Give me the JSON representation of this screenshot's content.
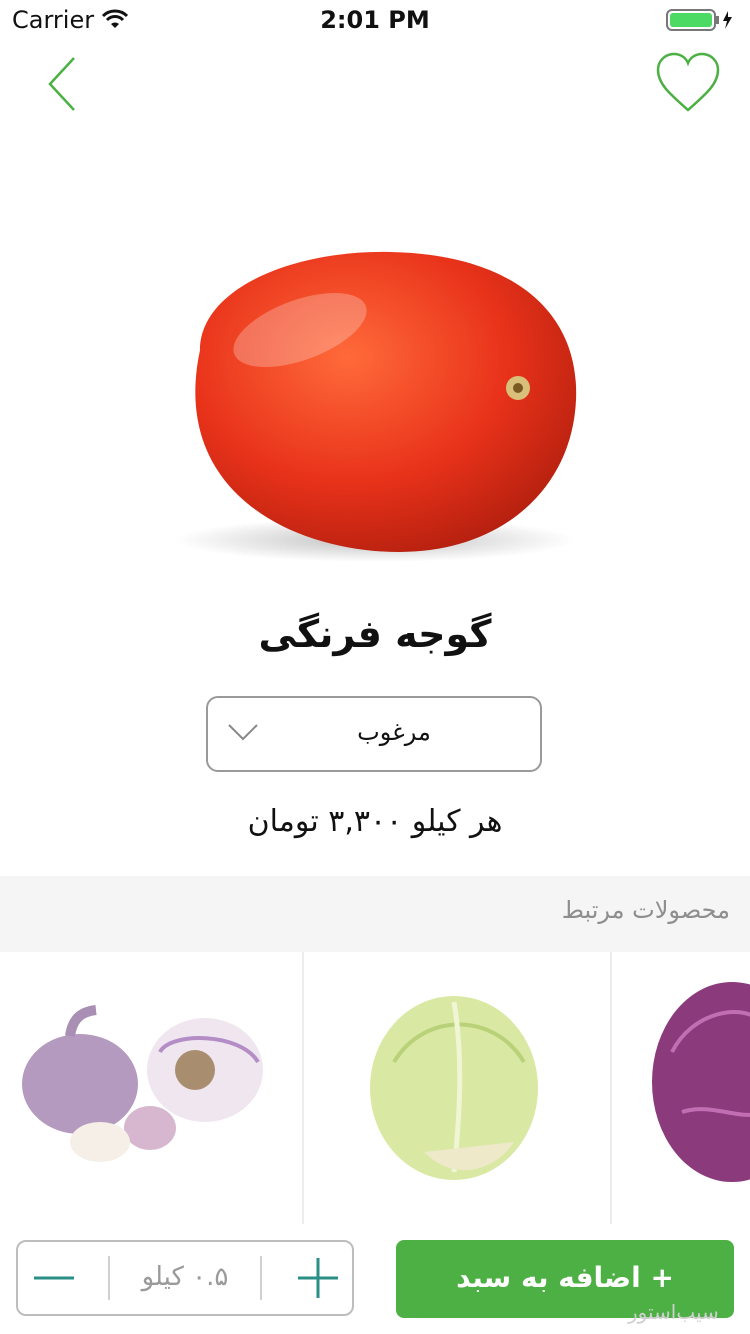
{
  "status_bar": {
    "carrier": "Carrier",
    "time": "2:01 PM"
  },
  "product": {
    "title": "گوجه فرنگی",
    "grade_selected": "مرغوب",
    "price_text": "هر کیلو ۳,۳۰۰ تومان"
  },
  "related": {
    "title": "محصولات مرتبط",
    "items": [
      {
        "icon": "garlic"
      },
      {
        "icon": "white-cabbage"
      },
      {
        "icon": "red-cabbage"
      }
    ]
  },
  "cart": {
    "quantity_text": "۰.۵ کیلو",
    "add_label": "+ اضافه به سبد"
  },
  "watermark": "سیب‌استور",
  "colors": {
    "accent": "#4db044",
    "stepper_icon": "#2a8f86"
  }
}
